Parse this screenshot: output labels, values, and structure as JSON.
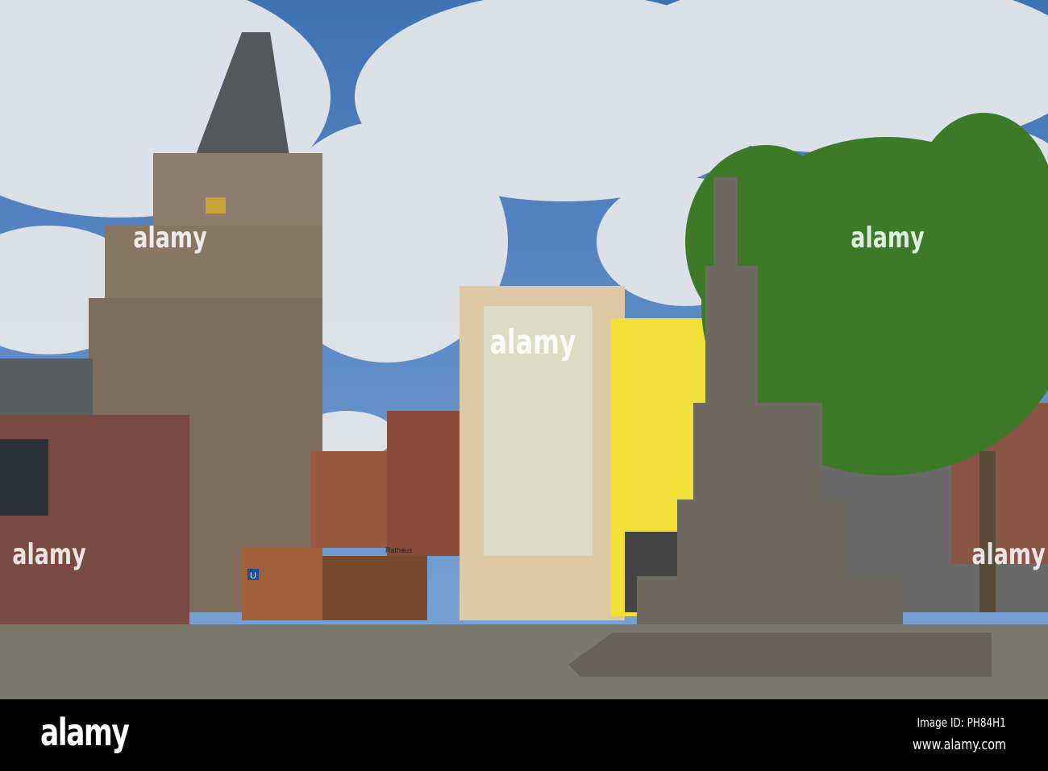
{
  "photo": {
    "description_signs": {
      "rathaus_sign": "Rathaus",
      "ubahn_sign": "U"
    },
    "colors": {
      "sky": "#4a7fc0",
      "cloud": "#e6e8ec",
      "tower": "#8a7a68",
      "yellow_house": "#f2e23a",
      "beige_house": "#e0c9a8",
      "tree": "#3f7a2a",
      "cobblestone": "#7e7a70"
    }
  },
  "watermark": {
    "text": "alamy"
  },
  "footer": {
    "logo": "alamy",
    "image_id": "Image ID: PH84H1",
    "url": "www.alamy.com"
  }
}
